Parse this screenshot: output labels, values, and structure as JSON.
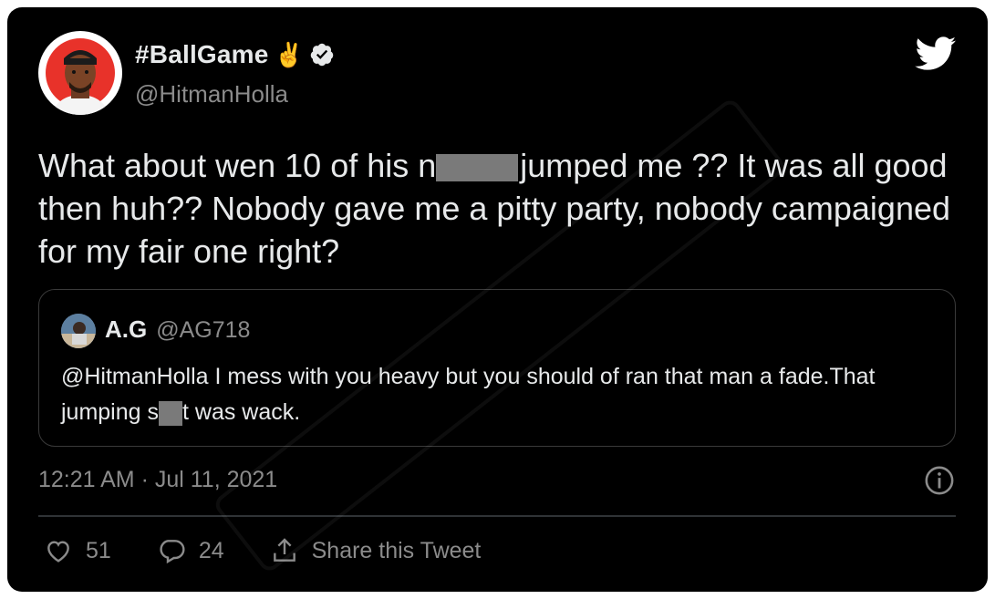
{
  "author": {
    "display_name": "#BallGame",
    "emoji": "✌️",
    "handle": "@HitmanHolla",
    "verified_icon": "verified-badge-icon",
    "avatar_icon": "avatar-illustration"
  },
  "brand_icon": "twitter-bird-icon",
  "tweet": {
    "text_part1": "What about wen 10 of his n",
    "text_part2": "jumped me ?? It was all good then huh?? Nobody gave me a pitty party, nobody campaigned for my fair one right?"
  },
  "quoted_tweet": {
    "name": "A.G",
    "handle": "@AG718",
    "text_part1": "@HitmanHolla I mess with you heavy but you should of ran that man a fade.That jumping s",
    "text_part2": "t was wack."
  },
  "timestamp": "12:21 AM · Jul 11, 2021",
  "info_icon": "info-icon",
  "actions": {
    "likes": "51",
    "replies": "24",
    "share_label": "Share this Tweet"
  },
  "colors": {
    "background": "#000000",
    "text_primary": "#e7e9ea",
    "text_secondary": "#8b8b8b",
    "border": "#3a3a3a",
    "twitter_bird": "#ffffff"
  }
}
